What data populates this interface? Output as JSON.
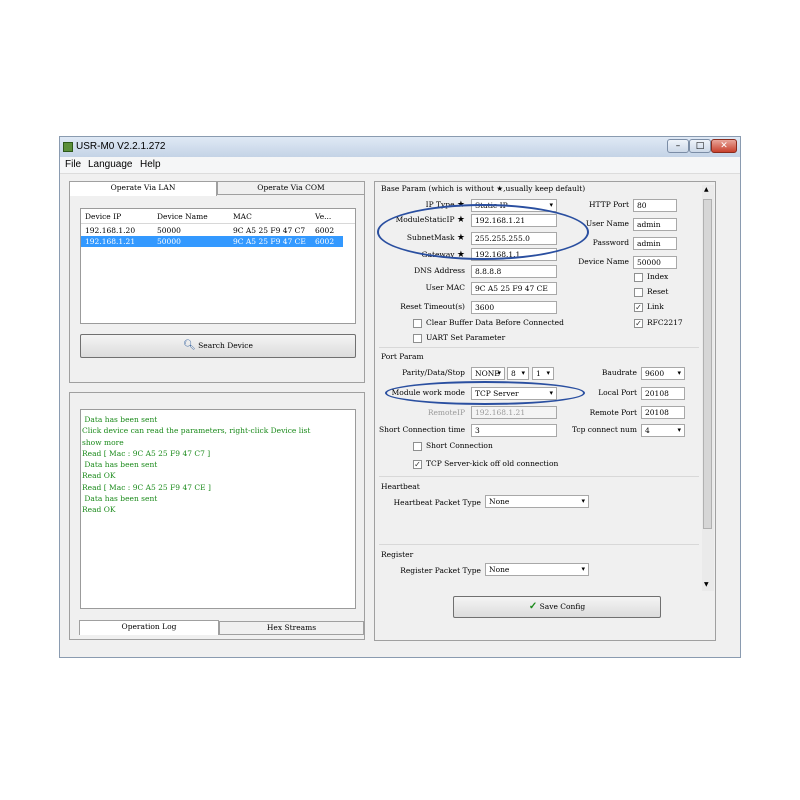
{
  "window": {
    "title": "USR-M0 V2.2.1.272",
    "minimize_label": "–",
    "maximize_label": "□",
    "close_label": "✕"
  },
  "menu": [
    "File",
    "Language",
    "Help"
  ],
  "left_tabs": [
    "Operate Via LAN",
    "Operate Via COM"
  ],
  "device_table": {
    "headers": [
      "Device IP",
      "Device Name",
      "MAC",
      "Ve..."
    ],
    "rows": [
      {
        "ip": "192.168.1.20",
        "name": "50000",
        "mac": "9C A5 25 F9 47 C7",
        "ver": "6002"
      },
      {
        "ip": "192.168.1.21",
        "name": "50000",
        "mac": "9C A5 25 F9 47 CE",
        "ver": "6002"
      }
    ]
  },
  "search_button": "Search Device",
  "log": [
    {
      "text": " Data has been sent",
      "color": "#1a8a1a"
    },
    {
      "text": "Click device can read the parameters, right-click Device list",
      "color": "#1a8a1a"
    },
    {
      "text": "show more",
      "color": "#1a8a1a"
    },
    {
      "text": "Read [ Mac : 9C A5 25 F9 47 C7 ]",
      "color": "#1a8a1a"
    },
    {
      "text": " Data has been sent",
      "color": "#1a8a1a"
    },
    {
      "text": "Read OK",
      "color": "#1a8a1a"
    },
    {
      "text": "Read [ Mac : 9C A5 25 F9 47 CE ]",
      "color": "#1a8a1a"
    },
    {
      "text": " Data has been sent",
      "color": "#1a8a1a"
    },
    {
      "text": "Read OK",
      "color": "#1a8a1a"
    }
  ],
  "bottom_tabs": [
    "Operation Log",
    "Hex Streams"
  ],
  "base": {
    "title": "Base Param (which is without ★,usually keep default)",
    "ip_type_label": "IP Type",
    "ip_type_value": "Static IP",
    "static_ip_label": "ModuleStaticIP",
    "static_ip_value": "192.168.1.21",
    "subnet_label": "SubnetMask",
    "subnet_value": "255.255.255.0",
    "gateway_label": "Gateway",
    "gateway_value": "192.168.1.1",
    "dns_label": "DNS Address",
    "dns_value": "8.8.8.8",
    "mac_label": "User MAC",
    "mac_value": "9C A5 25 F9 47 CE",
    "reset_label": "Reset Timeout(s)",
    "reset_value": "3600",
    "clear_buffer_label": "Clear Buffer Data Before Connected",
    "uart_label": "UART Set Parameter",
    "http_port_label": "HTTP Port",
    "http_port_value": "80",
    "user_name_label": "User Name",
    "user_name_value": "admin",
    "password_label": "Password",
    "password_value": "admin",
    "device_name_label": "Device Name",
    "device_name_value": "50000",
    "index_label": "Index",
    "reset_chk_label": "Reset",
    "link_label": "Link",
    "rfc_label": "RFC2217"
  },
  "port": {
    "title": "Port Param",
    "parity_label": "Parity/Data/Stop",
    "parity_value": "NONE",
    "data_value": "8",
    "stop_value": "1",
    "baud_label": "Baudrate",
    "baud_value": "9600",
    "mode_label": "Module work mode",
    "mode_value": "TCP Server",
    "local_port_label": "Local Port",
    "local_port_value": "20108",
    "remote_ip_label": "RemoteIP",
    "remote_ip_value": "192.168.1.21",
    "remote_port_label": "Remote Port",
    "remote_port_value": "20108",
    "short_time_label": "Short Connection time",
    "short_time_value": "3",
    "tcp_num_label": "Tcp connect num",
    "tcp_num_value": "4",
    "short_conn_label": "Short Connection",
    "kick_label": "TCP Server-kick off old connection"
  },
  "heartbeat": {
    "title": "Heartbeat",
    "type_label": "Heartbeat Packet Type",
    "type_value": "None"
  },
  "register": {
    "title": "Register",
    "type_label": "Register Packet Type",
    "type_value": "None"
  },
  "save_button": "Save Config",
  "star": "★",
  "arrow": "▾",
  "check": "✓",
  "colors": {
    "accent_ellipse": "#2a4fa0",
    "selection": "#3399ff",
    "log_text": "#1a8a1a"
  }
}
